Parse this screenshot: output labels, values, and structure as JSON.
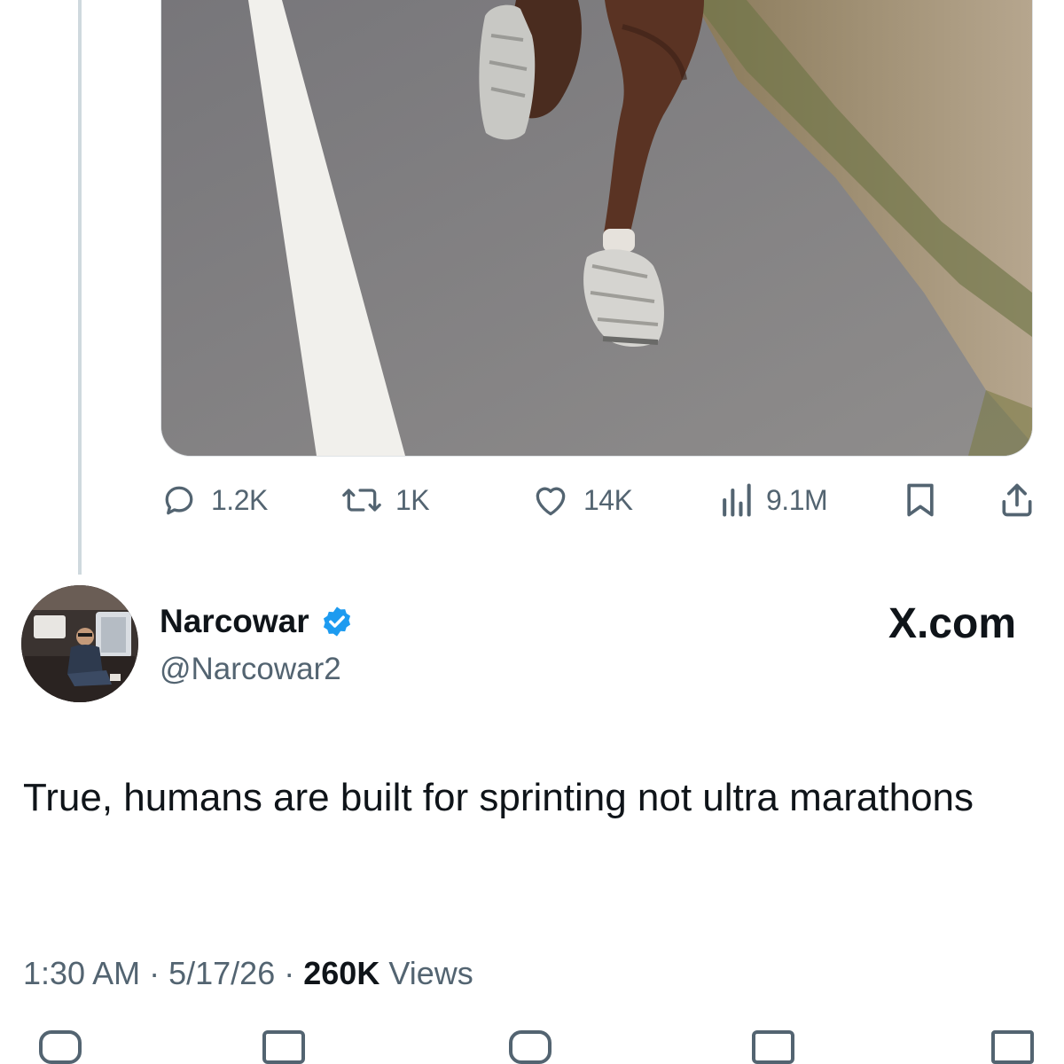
{
  "post_actions": {
    "replies": "1.2K",
    "reposts": "1K",
    "likes": "14K",
    "views": "9.1M"
  },
  "author": {
    "name": "Narcowar",
    "handle": "@Narcowar2",
    "verified": true
  },
  "brand": "X.com",
  "tweet": {
    "text": "True, humans are built for sprinting not ultra marathons",
    "time": "1:30 AM",
    "date": "5/17/26",
    "views_count": "260K",
    "views_label": "Views"
  },
  "colors": {
    "text": "#0f1419",
    "secondary": "#536471",
    "verified": "#1d9bf0",
    "thread_line": "#cfd9de"
  }
}
